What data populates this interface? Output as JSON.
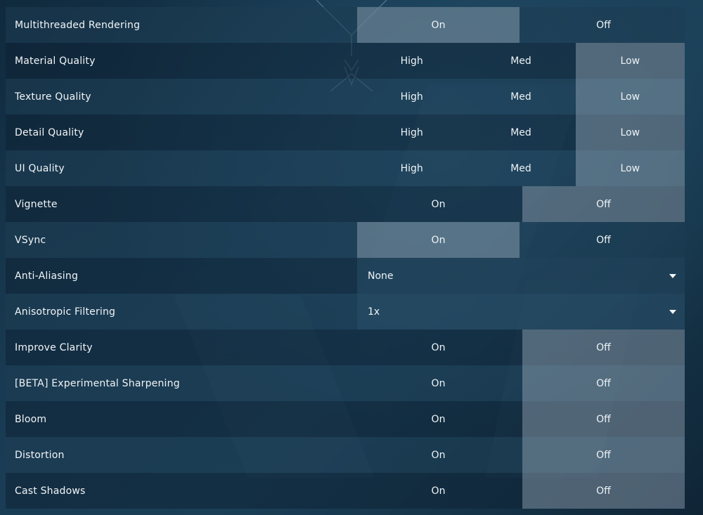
{
  "settings": [
    {
      "id": "multithreaded-rendering",
      "label": "Multithreaded Rendering",
      "type": "toggle",
      "options": [
        "On",
        "Off"
      ],
      "selected": 0
    },
    {
      "id": "material-quality",
      "label": "Material Quality",
      "type": "triple",
      "options": [
        "High",
        "Med",
        "Low"
      ],
      "selected": 2
    },
    {
      "id": "texture-quality",
      "label": "Texture Quality",
      "type": "triple",
      "options": [
        "High",
        "Med",
        "Low"
      ],
      "selected": 2
    },
    {
      "id": "detail-quality",
      "label": "Detail Quality",
      "type": "triple",
      "options": [
        "High",
        "Med",
        "Low"
      ],
      "selected": 2
    },
    {
      "id": "ui-quality",
      "label": "UI Quality",
      "type": "triple",
      "options": [
        "High",
        "Med",
        "Low"
      ],
      "selected": 2
    },
    {
      "id": "vignette",
      "label": "Vignette",
      "type": "toggle",
      "options": [
        "On",
        "Off"
      ],
      "selected": 1
    },
    {
      "id": "vsync",
      "label": "VSync",
      "type": "toggle",
      "options": [
        "On",
        "Off"
      ],
      "selected": 0
    },
    {
      "id": "anti-aliasing",
      "label": "Anti-Aliasing",
      "type": "dropdown",
      "value": "None"
    },
    {
      "id": "anisotropic-filtering",
      "label": "Anisotropic Filtering",
      "type": "dropdown",
      "value": "1x"
    },
    {
      "id": "improve-clarity",
      "label": "Improve Clarity",
      "type": "toggle",
      "options": [
        "On",
        "Off"
      ],
      "selected": 1
    },
    {
      "id": "experimental-sharpening",
      "label": "[BETA] Experimental Sharpening",
      "type": "toggle",
      "options": [
        "On",
        "Off"
      ],
      "selected": 1
    },
    {
      "id": "bloom",
      "label": "Bloom",
      "type": "toggle",
      "options": [
        "On",
        "Off"
      ],
      "selected": 1
    },
    {
      "id": "distortion",
      "label": "Distortion",
      "type": "toggle",
      "options": [
        "On",
        "Off"
      ],
      "selected": 1
    },
    {
      "id": "cast-shadows",
      "label": "Cast Shadows",
      "type": "toggle",
      "options": [
        "On",
        "Off"
      ],
      "selected": 1
    }
  ],
  "icons": {
    "dropdown_caret": "caret-down-icon",
    "background_emblem": "emblem-icon"
  },
  "colors": {
    "selected_option": "#8fa3b3",
    "text": "#ffffff"
  }
}
